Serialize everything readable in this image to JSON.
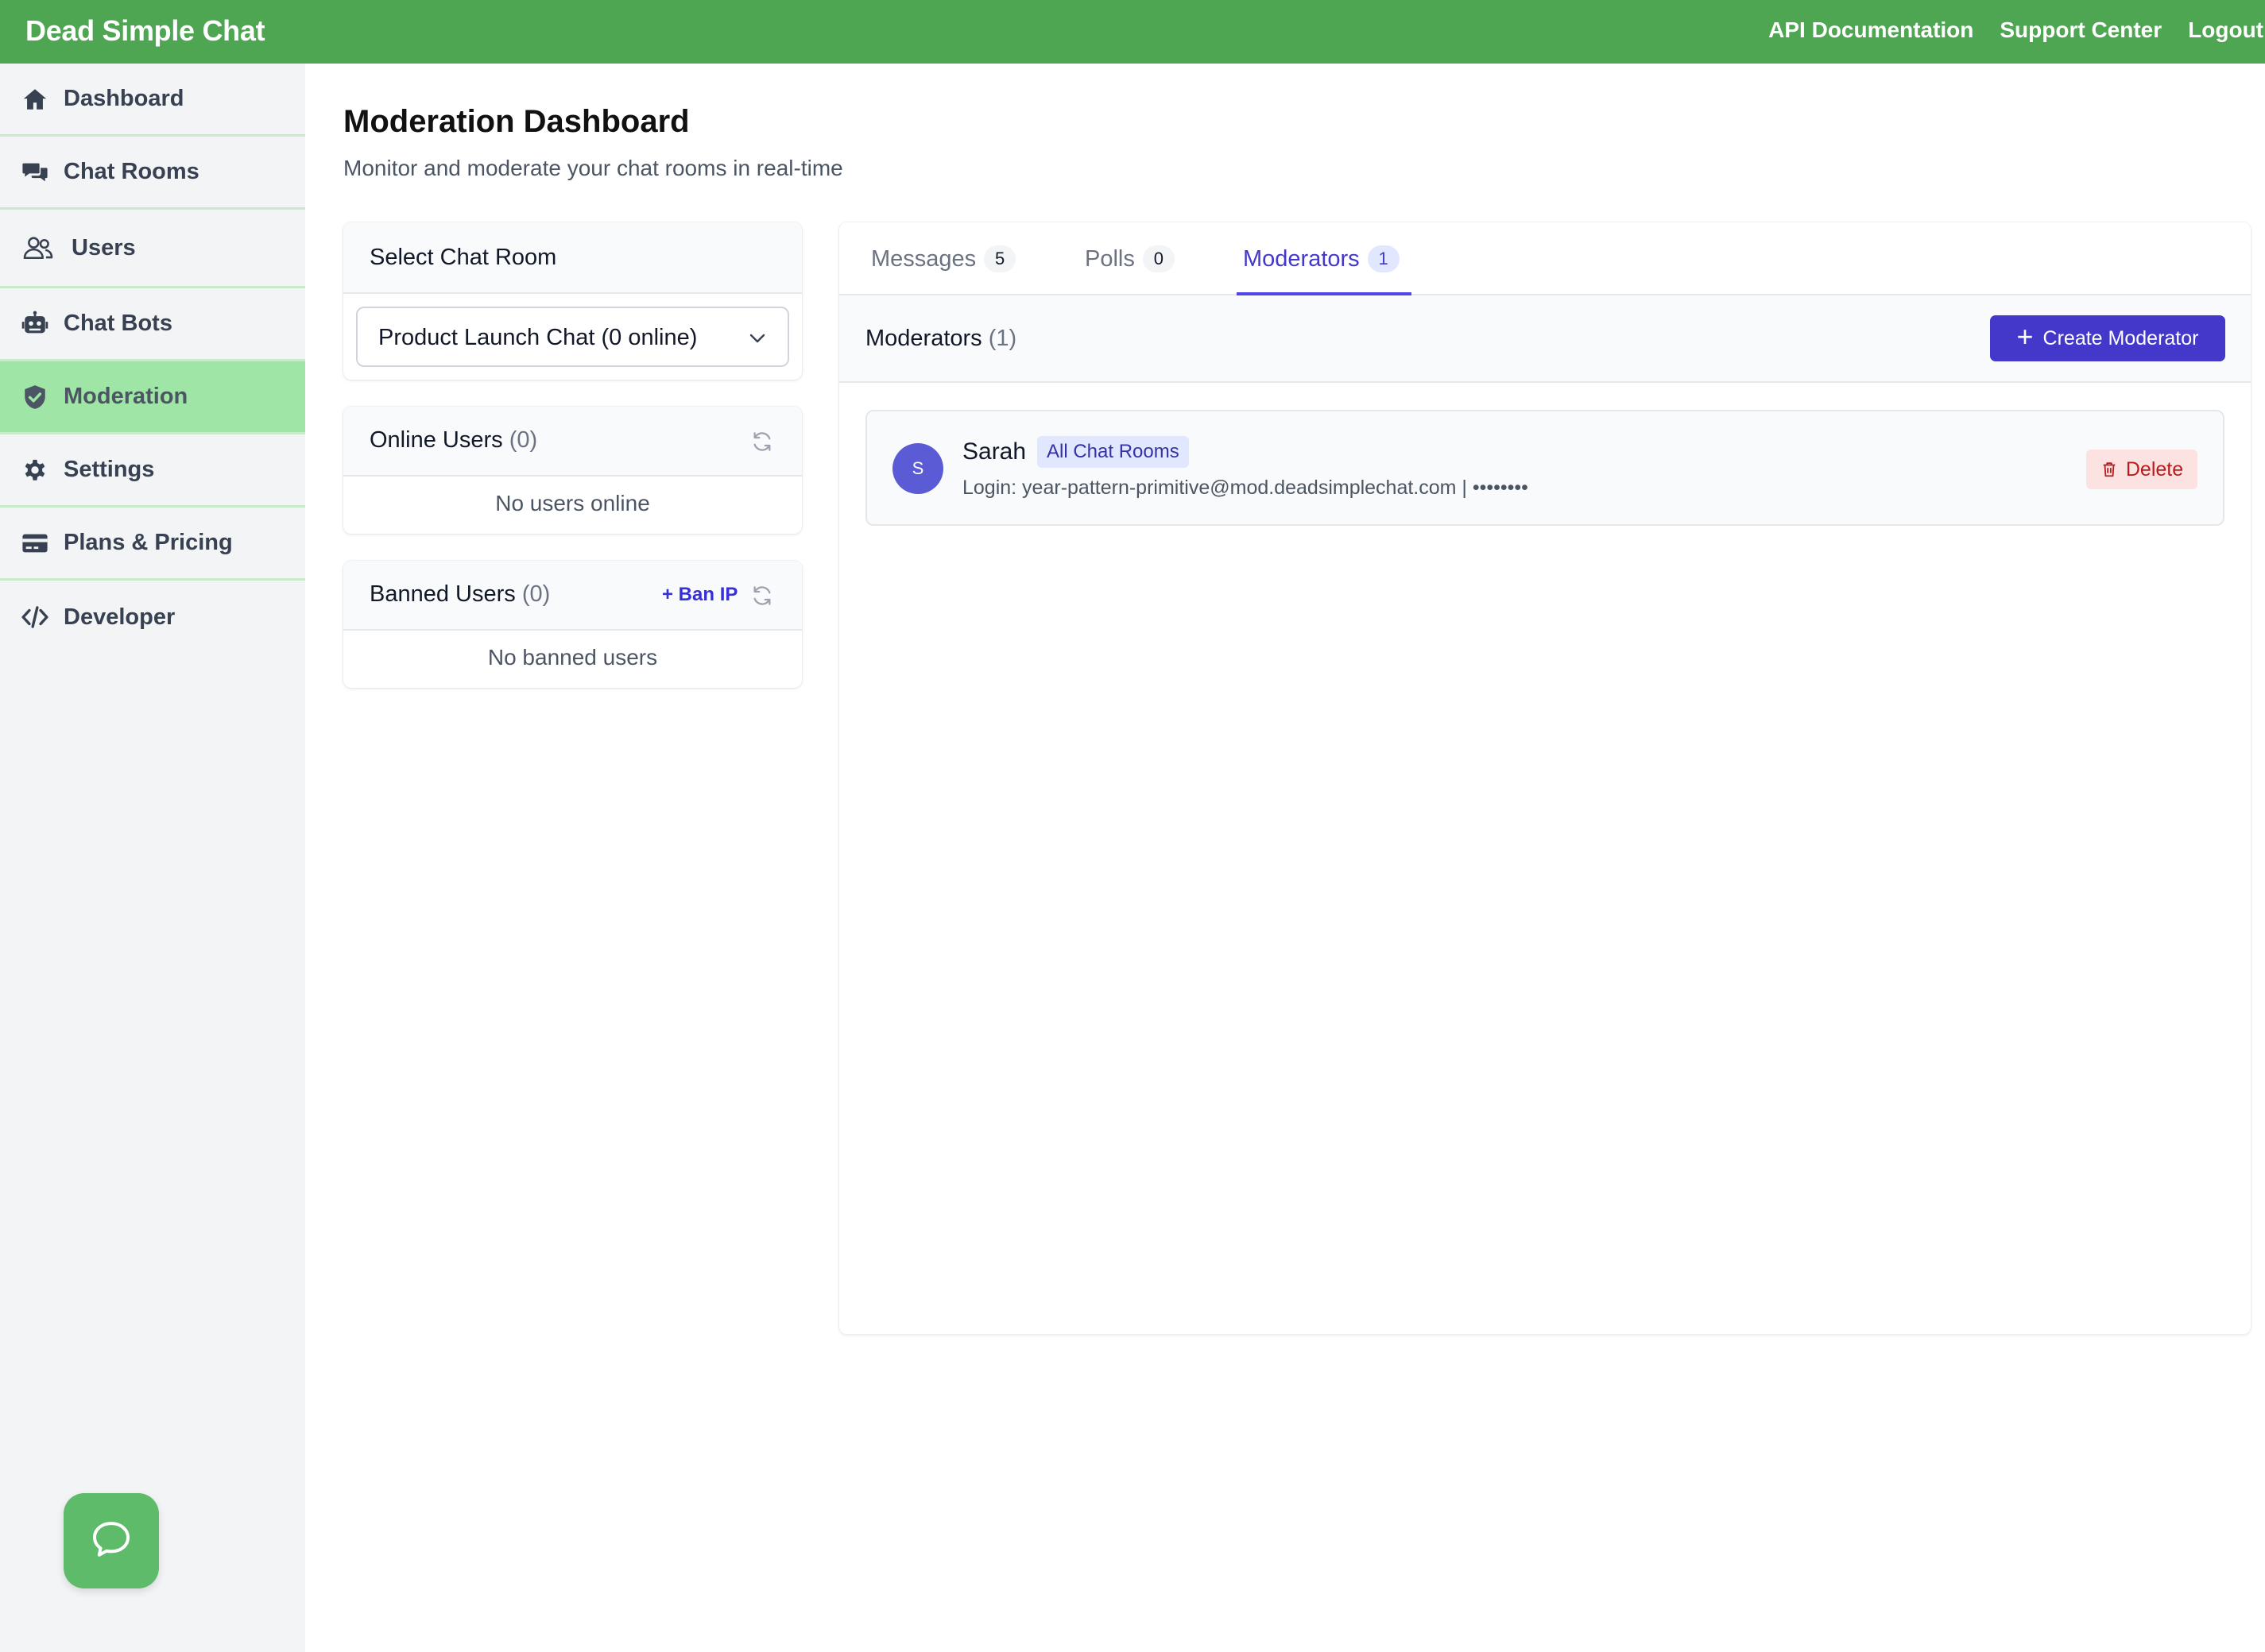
{
  "app": {
    "brand": "Dead Simple Chat",
    "nav": [
      "API Documentation",
      "Support Center",
      "Logout"
    ],
    "brand_color": "#4ea653"
  },
  "sidebar": {
    "items": [
      {
        "label": "Dashboard",
        "icon": "home-icon"
      },
      {
        "label": "Chat Rooms",
        "icon": "chat-rooms-icon"
      },
      {
        "label": "Users",
        "icon": "users-icon"
      },
      {
        "label": "Chat Bots",
        "icon": "robot-icon"
      },
      {
        "label": "Moderation",
        "icon": "shield-icon",
        "active": true
      },
      {
        "label": "Settings",
        "icon": "gear-icon"
      },
      {
        "label": "Plans & Pricing",
        "icon": "credit-card-icon"
      },
      {
        "label": "Developer",
        "icon": "code-icon"
      }
    ],
    "active_color": "#9fe5a6"
  },
  "page": {
    "title": "Moderation Dashboard",
    "subtitle": "Monitor and moderate your chat rooms in real-time"
  },
  "room_select": {
    "title": "Select Chat Room",
    "value": "Product Launch Chat (0 online)"
  },
  "online_users": {
    "title": "Online Users",
    "count": "(0)",
    "empty": "No users online"
  },
  "banned_users": {
    "title": "Banned Users",
    "count": "(0)",
    "ban_ip": "+ Ban IP",
    "empty": "No banned users"
  },
  "tabs": [
    {
      "label": "Messages",
      "badge": "5"
    },
    {
      "label": "Polls",
      "badge": "0"
    },
    {
      "label": "Moderators",
      "badge": "1",
      "active": true
    }
  ],
  "moderators": {
    "title": "Moderators",
    "count": "(1)",
    "create_label": "Create Moderator",
    "accent": "#4338ca",
    "list": [
      {
        "initial": "S",
        "name": "Sarah",
        "scope": "All Chat Rooms",
        "login": "Login: year-pattern-primitive@mod.deadsimplechat.com  |  ••••••••",
        "delete_label": "Delete"
      }
    ]
  }
}
